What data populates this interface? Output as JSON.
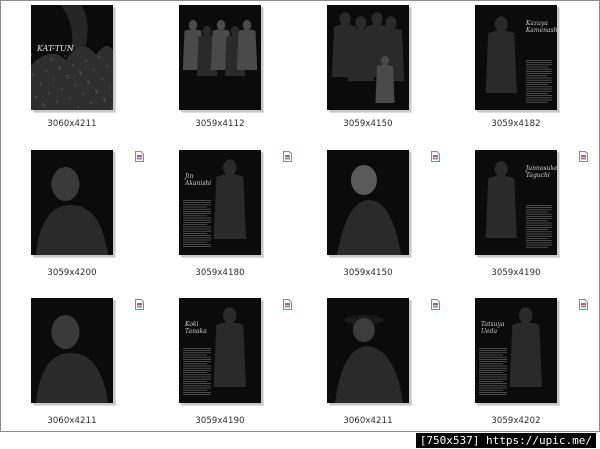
{
  "thumbnails": [
    {
      "caption": "3060x4211",
      "title_text": "KAT-TUN",
      "has_file_icon": false,
      "scene": "group-rock"
    },
    {
      "caption": "3059x4112",
      "title_text": "",
      "has_file_icon": false,
      "scene": "group-five"
    },
    {
      "caption": "3059x4150",
      "title_text": "",
      "has_file_icon": false,
      "scene": "group-stand"
    },
    {
      "caption": "3059x4182",
      "title_text": "Kazuya Kamenashi",
      "has_file_icon": false,
      "scene": "solo-text-right"
    },
    {
      "caption": "3059x4200",
      "title_text": "",
      "has_file_icon": true,
      "scene": "solo-close"
    },
    {
      "caption": "3059x4180",
      "title_text": "Jin Akanishi",
      "has_file_icon": true,
      "scene": "solo-text-left"
    },
    {
      "caption": "3059x4150",
      "title_text": "",
      "has_file_icon": true,
      "scene": "solo-look-up"
    },
    {
      "caption": "3059x4190",
      "title_text": "Junnosuke Taguchi",
      "has_file_icon": true,
      "scene": "solo-text-right"
    },
    {
      "caption": "3060x4211",
      "title_text": "",
      "has_file_icon": true,
      "scene": "solo-close"
    },
    {
      "caption": "3059x4190",
      "title_text": "Koki Tanaka",
      "has_file_icon": true,
      "scene": "solo-text-left"
    },
    {
      "caption": "3060x4211",
      "title_text": "",
      "has_file_icon": true,
      "scene": "solo-hat"
    },
    {
      "caption": "3059x4202",
      "title_text": "Tatsuya Ueda",
      "has_file_icon": true,
      "scene": "solo-text-left"
    }
  ],
  "footer": {
    "text": "[750x537] https://upic.me/"
  },
  "colors": {
    "photo_bg": "#0b0b0b",
    "figure": "#2a2a2a",
    "figure_light": "#4a4a4a",
    "text_gray": "#9a9a9a",
    "footer_bg": "#000000"
  },
  "icons": {
    "file": "image-file-icon"
  }
}
